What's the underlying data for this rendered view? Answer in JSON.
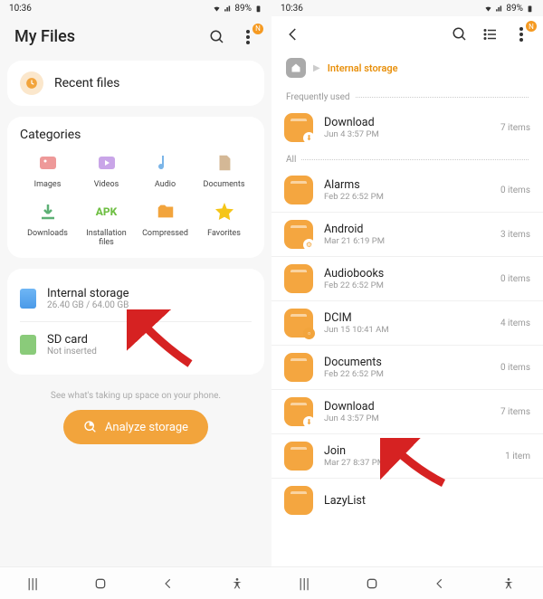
{
  "status": {
    "time": "10:36",
    "battery": "89%"
  },
  "screen1": {
    "title": "My Files",
    "recent_label": "Recent files",
    "categories_title": "Categories",
    "categories": [
      {
        "label": "Images"
      },
      {
        "label": "Videos"
      },
      {
        "label": "Audio"
      },
      {
        "label": "Documents"
      },
      {
        "label": "Downloads"
      },
      {
        "label": "Installation files"
      },
      {
        "label": "Compressed"
      },
      {
        "label": "Favorites"
      }
    ],
    "internal": {
      "title": "Internal storage",
      "sub": "26.40 GB / 64.00 GB"
    },
    "sdcard": {
      "title": "SD card",
      "sub": "Not inserted"
    },
    "hint": "See what's taking up space on your phone.",
    "analyze": "Analyze storage",
    "badge": "N"
  },
  "screen2": {
    "crumb_current": "Internal storage",
    "section_freq": "Frequently used",
    "section_all": "All",
    "badge": "N",
    "freq": [
      {
        "name": "Download",
        "date": "Jun 4 3:57 PM",
        "count": "7 items",
        "sub": "dl"
      }
    ],
    "all": [
      {
        "name": "Alarms",
        "date": "Feb 22 6:52 PM",
        "count": "0 items"
      },
      {
        "name": "Android",
        "date": "Mar 21 6:19 PM",
        "count": "3 items",
        "sub": "gear"
      },
      {
        "name": "Audiobooks",
        "date": "Feb 22 6:52 PM",
        "count": "0 items"
      },
      {
        "name": "DCIM",
        "date": "Jun 15 10:41 AM",
        "count": "4 items",
        "sub": "dot"
      },
      {
        "name": "Documents",
        "date": "Feb 22 6:52 PM",
        "count": "0 items"
      },
      {
        "name": "Download",
        "date": "Jun 4 3:57 PM",
        "count": "7 items",
        "sub": "dl"
      },
      {
        "name": "Join",
        "date": "Mar 27 8:37 PM",
        "count": "1 item"
      },
      {
        "name": "LazyList",
        "date": "",
        "count": ""
      }
    ]
  }
}
